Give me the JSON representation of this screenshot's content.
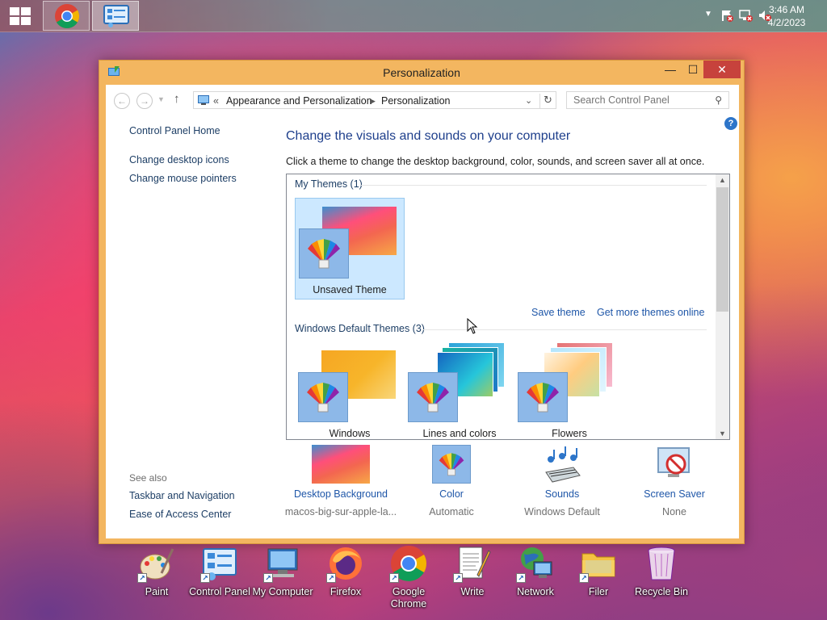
{
  "taskbar": {
    "time": "3:46 AM",
    "date": "4/2/2023",
    "apps": [
      {
        "name": "Google Chrome",
        "icon": "chrome-icon"
      },
      {
        "name": "Control Panel",
        "icon": "control-panel-icon"
      }
    ],
    "tray_icons": [
      "chevron-up-icon",
      "flag-error-icon",
      "network-error-icon",
      "volume-muted-icon"
    ]
  },
  "window": {
    "title": "Personalization",
    "controls": {
      "minimize": "—",
      "maximize": "☐",
      "close": "✕"
    },
    "address": {
      "prefix": "«",
      "segments": [
        "Appearance and Personalization",
        "Personalization"
      ]
    },
    "search": {
      "placeholder": "Search Control Panel"
    },
    "left_nav": {
      "links": [
        "Control Panel Home",
        "Change desktop icons",
        "Change mouse pointers"
      ],
      "see_also_label": "See also",
      "see_also": [
        "Taskbar and Navigation",
        "Ease of Access Center"
      ]
    },
    "heading": "Change the visuals and sounds on your computer",
    "subtext": "Click a theme to change the desktop background, color, sounds, and screen saver all at once.",
    "my_themes": {
      "header": "My Themes (1)",
      "items": [
        {
          "name": "Unsaved Theme",
          "selected": true
        }
      ],
      "actions": {
        "save": "Save theme",
        "more": "Get more themes online"
      }
    },
    "default_themes": {
      "header": "Windows Default Themes (3)",
      "items": [
        {
          "name": "Windows"
        },
        {
          "name": "Lines and colors"
        },
        {
          "name": "Flowers"
        }
      ]
    },
    "bottom_bar": [
      {
        "label": "Desktop Background",
        "sub": "macos-big-sur-apple-la...",
        "icon": "desktop-background-icon"
      },
      {
        "label": "Color",
        "sub": "Automatic",
        "icon": "color-palette-icon"
      },
      {
        "label": "Sounds",
        "sub": "Windows Default",
        "icon": "sounds-icon"
      },
      {
        "label": "Screen Saver",
        "sub": "None",
        "icon": "screen-saver-icon"
      }
    ],
    "help_icon": "?"
  },
  "desktop_icons": [
    {
      "label": "Paint",
      "icon": "paint-icon"
    },
    {
      "label": "Control Panel",
      "icon": "control-panel-icon"
    },
    {
      "label": "My Computer",
      "icon": "computer-icon"
    },
    {
      "label": "Firefox",
      "icon": "firefox-icon"
    },
    {
      "label": "Google Chrome",
      "icon": "chrome-icon"
    },
    {
      "label": "Write",
      "icon": "write-icon"
    },
    {
      "label": "Network",
      "icon": "network-icon"
    },
    {
      "label": "Filer",
      "icon": "folder-icon"
    },
    {
      "label": "Recycle Bin",
      "icon": "recycle-bin-icon"
    }
  ]
}
